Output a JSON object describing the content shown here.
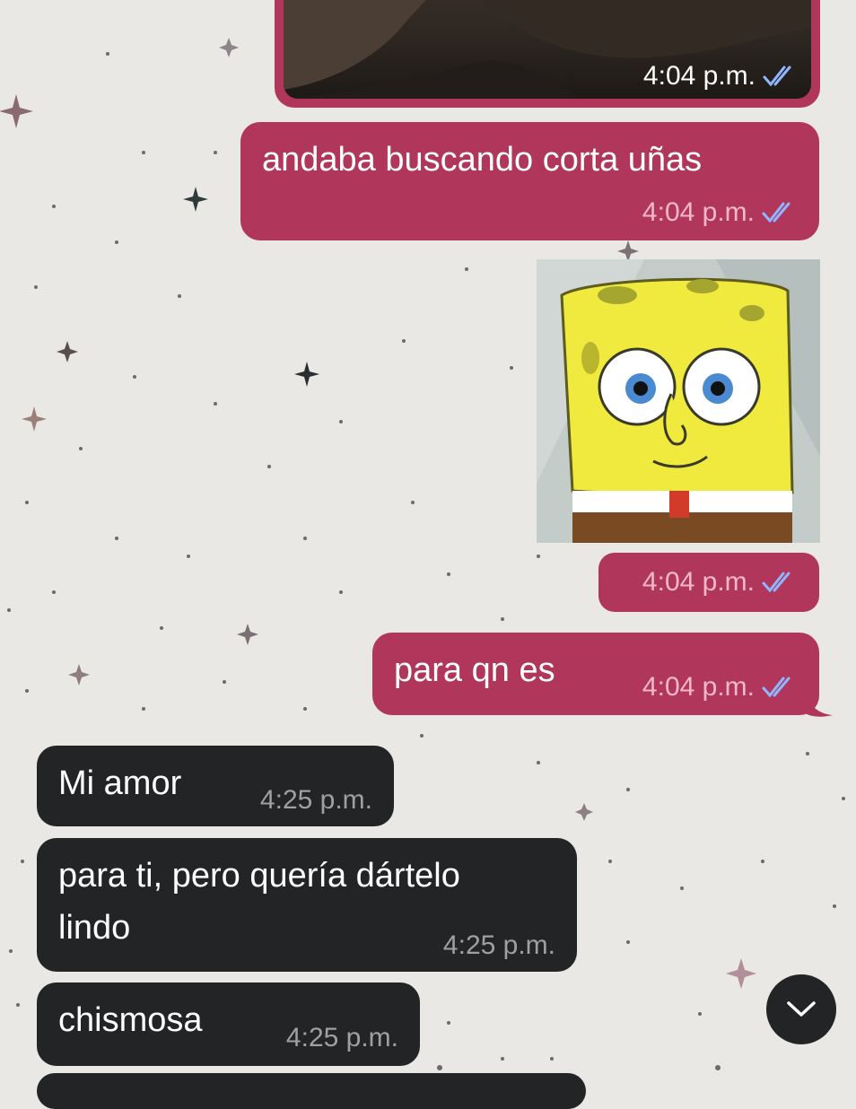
{
  "chat": {
    "messages": [
      {
        "id": "photo",
        "direction": "outgoing",
        "type": "photo",
        "time": "4:04 p.m.",
        "status": "read"
      },
      {
        "id": "m1",
        "direction": "outgoing",
        "type": "text",
        "text": "andaba buscando corta uñas",
        "time": "4:04 p.m.",
        "status": "read"
      },
      {
        "id": "sticker",
        "direction": "outgoing",
        "type": "sticker",
        "sticker_name": "spongebob-sticker",
        "time": "4:04 p.m.",
        "status": "read"
      },
      {
        "id": "m2",
        "direction": "outgoing",
        "type": "text",
        "text": "para qn es",
        "time": "4:04 p.m.",
        "status": "read"
      },
      {
        "id": "m3",
        "direction": "incoming",
        "type": "text",
        "text": "Mi amor",
        "time": "4:25 p.m."
      },
      {
        "id": "m4",
        "direction": "incoming",
        "type": "text",
        "text_lines": [
          "para ti, pero quería dártelo",
          "lindo"
        ],
        "time": "4:25 p.m."
      },
      {
        "id": "m5",
        "direction": "incoming",
        "type": "text",
        "text": "chismosa",
        "time": "4:25 p.m."
      }
    ],
    "scroll_button_icon": "chevron-down-icon"
  },
  "colors": {
    "background": "#e9e8e4",
    "outgoing_bubble": "#b0365b",
    "incoming_bubble": "#232425",
    "read_ticks": "#8fb6ff"
  }
}
